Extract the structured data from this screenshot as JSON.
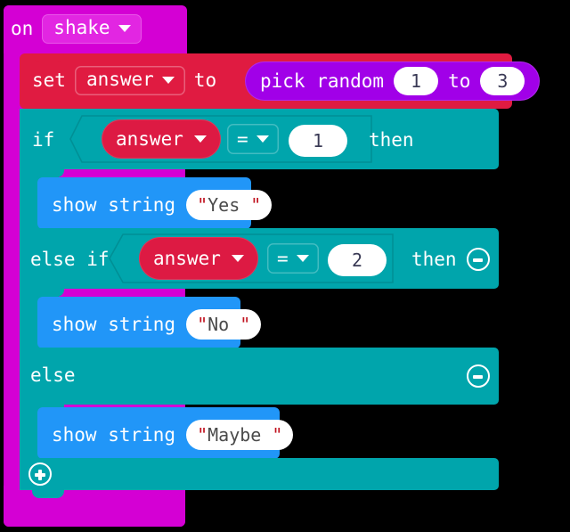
{
  "workspace": {
    "background": "#000000"
  },
  "colors": {
    "event": "#D400D4",
    "event_field": "#E226E2",
    "variable_set": "#E01B41",
    "variable_reporter": "#DD1A43",
    "math_reporter": "#A100E8",
    "logic": "#00A5AC",
    "basic_show": "#2196F8",
    "field_text": "#4A4A4A",
    "quote_mark": "#C1121F"
  },
  "event_block": {
    "name": "on-shake-event",
    "prefix_label": "on",
    "event_value": "shake",
    "dropdown_icon": "chevron-down-icon"
  },
  "set_block": {
    "name": "set-variable-block",
    "set_label": "set",
    "variable_name": "answer",
    "to_label": "to",
    "dropdown_icon": "chevron-down-icon",
    "value_block": {
      "name": "pick-random-block",
      "label": "pick random",
      "to_label": "to",
      "min": "1",
      "max": "3"
    }
  },
  "conditional": {
    "name": "if-elseif-else-block",
    "branches": [
      {
        "keyword": "if",
        "then_label": "then",
        "condition": {
          "left_variable": "answer",
          "operator": "=",
          "right_value": "1",
          "dropdown_icon": "chevron-down-icon"
        },
        "mutator_icon": null,
        "body": {
          "name": "show-string-block",
          "label": "show string",
          "value": "\"Yes \"",
          "open_quote": "\"",
          "text": "Yes ",
          "close_quote": "\""
        }
      },
      {
        "keyword": "else if",
        "then_label": "then",
        "condition": {
          "left_variable": "answer",
          "operator": "=",
          "right_value": "2",
          "dropdown_icon": "chevron-down-icon"
        },
        "mutator_icon": "minus-icon",
        "body": {
          "name": "show-string-block",
          "label": "show string",
          "value": "\"No \"",
          "open_quote": "\"",
          "text": "No ",
          "close_quote": "\""
        }
      },
      {
        "keyword": "else",
        "then_label": "",
        "condition": null,
        "mutator_icon": "minus-icon",
        "body": {
          "name": "show-string-block",
          "label": "show string",
          "value": "\"Maybe \"",
          "open_quote": "\"",
          "text": "Maybe ",
          "close_quote": "\""
        }
      }
    ],
    "add_branch_icon": "plus-icon"
  }
}
